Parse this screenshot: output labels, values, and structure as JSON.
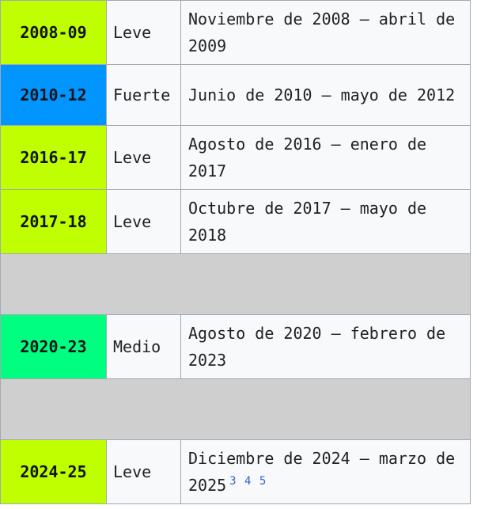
{
  "rows": [
    {
      "kind": "event",
      "period": "2008-09",
      "color": "#bfff00",
      "intensity": "Leve",
      "dates": "Noviembre de 2008 – abril de 2009",
      "refs": []
    },
    {
      "kind": "event",
      "period": "2010-12",
      "color": "#0095ff",
      "intensity": "Fuerte",
      "dates": "Junio de 2010 – mayo de 2012",
      "refs": []
    },
    {
      "kind": "event",
      "period": "2016-17",
      "color": "#bfff00",
      "intensity": "Leve",
      "dates": "Agosto de 2016 – enero de 2017",
      "refs": []
    },
    {
      "kind": "event",
      "period": "2017-18",
      "color": "#bfff00",
      "intensity": "Leve",
      "dates": "Octubre de 2017 – mayo de 2018",
      "refs": []
    },
    {
      "kind": "gap"
    },
    {
      "kind": "event",
      "period": "2020-23",
      "color": "#00ff80",
      "intensity": "Medio",
      "dates": "Agosto de 2020 – febrero de 2023",
      "refs": []
    },
    {
      "kind": "gap"
    },
    {
      "kind": "event",
      "period": "2024-25",
      "color": "#bfff00",
      "intensity": "Leve",
      "dates": "Diciembre de 2024 – marzo de 2025",
      "refs": [
        "3",
        "4",
        "5"
      ]
    }
  ],
  "colors": {
    "border": "#a2a9b1",
    "gap": "#cfcfcf",
    "cell_bg": "#f8f9fa",
    "link": "#3366cc"
  }
}
